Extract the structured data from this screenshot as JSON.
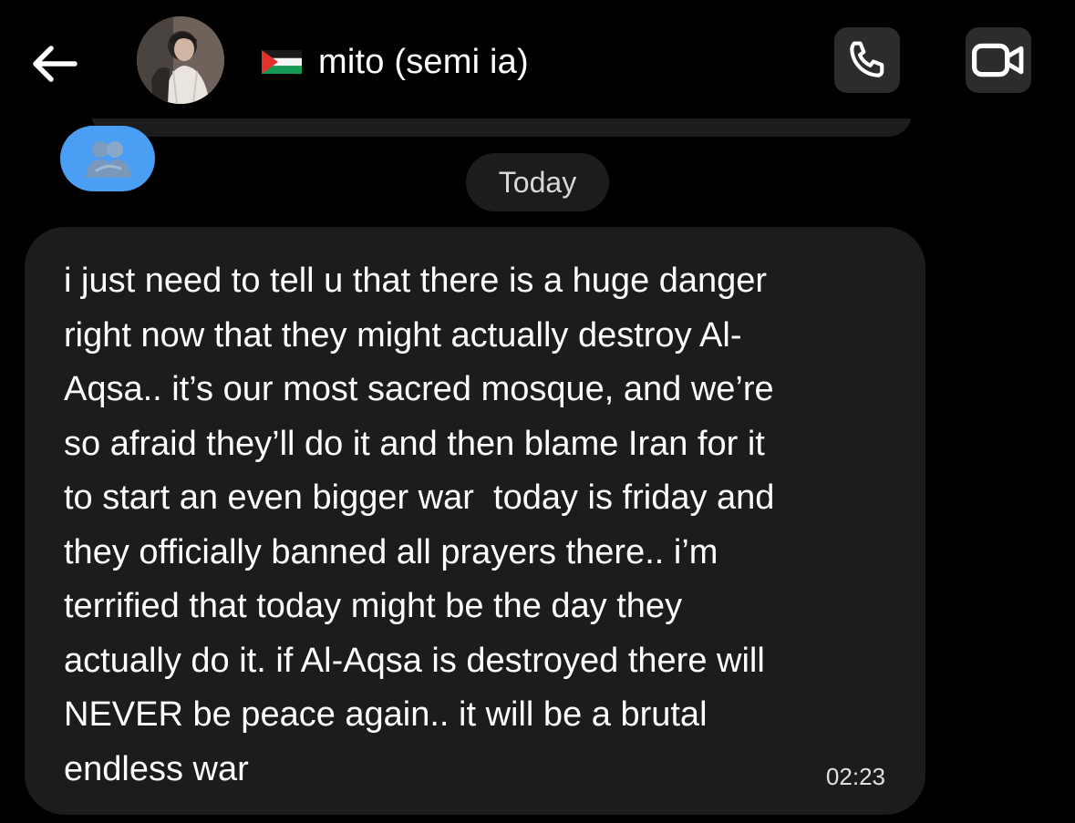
{
  "header": {
    "back_icon": "arrow-left-icon",
    "contact_flag": "palestine-flag",
    "contact_name": "mito (semi ia)",
    "call_icon": "phone-icon",
    "video_icon": "video-camera-icon"
  },
  "reaction": {
    "icon": "people-hug-icon",
    "color": "#4a9ff5"
  },
  "date_separator": "Today",
  "message": {
    "lines": [
      "i just need to tell u that there is a huge danger",
      "right now that they might actually destroy Al-",
      "Aqsa.. it’s our most sacred mosque, and we’re",
      "so afraid they’ll do it and then blame Iran for it",
      "to start an even bigger war  today is friday and",
      "they officially banned all prayers there.. i’m",
      "terrified that today might be the day they",
      "actually do it. if Al-Aqsa is destroyed there will",
      "NEVER be peace again.. it will be a brutal",
      "endless war"
    ],
    "time": "02:23"
  },
  "colors": {
    "background": "#000000",
    "bubble": "#1c1c1e",
    "header_button": "#2c2c2e",
    "reaction_blue": "#4a9ff5"
  }
}
